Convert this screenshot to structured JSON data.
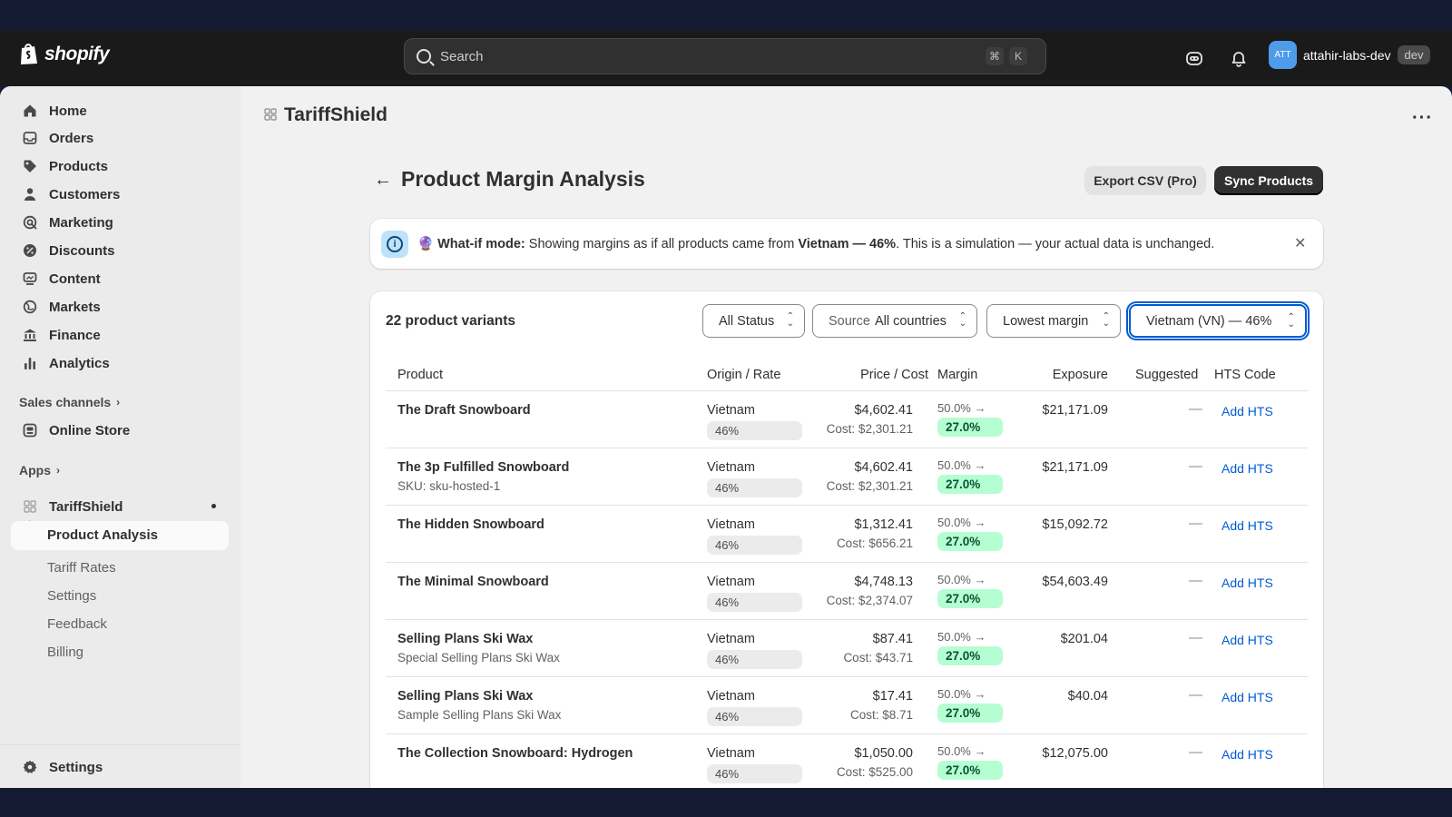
{
  "topbar": {
    "brand": "shopify",
    "search_placeholder": "Search",
    "shortcut_keys": [
      "⌘",
      "K"
    ],
    "avatar_initials": "ATT",
    "store_name": "attahir-labs-dev",
    "env_badge": "dev"
  },
  "sidebar": {
    "items": [
      {
        "label": "Home",
        "icon": "home-icon"
      },
      {
        "label": "Orders",
        "icon": "inbox-icon"
      },
      {
        "label": "Products",
        "icon": "tag-icon"
      },
      {
        "label": "Customers",
        "icon": "person-icon"
      },
      {
        "label": "Marketing",
        "icon": "target-icon"
      },
      {
        "label": "Discounts",
        "icon": "discount-icon"
      },
      {
        "label": "Content",
        "icon": "content-icon"
      },
      {
        "label": "Markets",
        "icon": "globe-icon"
      },
      {
        "label": "Finance",
        "icon": "bank-icon"
      },
      {
        "label": "Analytics",
        "icon": "bar-chart-icon"
      }
    ],
    "sales_channels_label": "Sales channels",
    "online_store_label": "Online Store",
    "apps_label": "Apps",
    "app_name": "TariffShield",
    "app_subitems": [
      "Product Analysis",
      "Tariff Rates",
      "Settings",
      "Feedback",
      "Billing"
    ],
    "settings_label": "Settings"
  },
  "main": {
    "app_title": "TariffShield",
    "page_title": "Product Margin Analysis",
    "export_label": "Export CSV (Pro)",
    "sync_label": "Sync Products"
  },
  "banner": {
    "emoji": "🔮",
    "lead": "What-if mode:",
    "text1": " Showing margins as if all products came from ",
    "highlight": "Vietnam — 46%",
    "text2": ". This is a simulation — your actual data is unchanged."
  },
  "card": {
    "count_label": "22 product variants",
    "filters": {
      "status": "All Status",
      "source_prefix": "Source",
      "source_value": "All countries",
      "sort": "Lowest margin",
      "scenario": "Vietnam (VN) — 46%"
    },
    "columns": [
      "Product",
      "Origin / Rate",
      "Price / Cost",
      "Margin",
      "Exposure",
      "Suggested",
      "HTS Code"
    ],
    "rows": [
      {
        "name": "The Draft Snowboard",
        "sub": "",
        "origin": "Vietnam",
        "rate": "46%",
        "price": "$4,602.41",
        "cost": "Cost: $2,301.21",
        "margin_old": "50.0% →",
        "margin_new": "27.0%",
        "exposure": "$21,171.09",
        "suggested": "—",
        "hts": "Add HTS"
      },
      {
        "name": "The 3p Fulfilled Snowboard",
        "sub": "SKU: sku-hosted-1",
        "origin": "Vietnam",
        "rate": "46%",
        "price": "$4,602.41",
        "cost": "Cost: $2,301.21",
        "margin_old": "50.0% →",
        "margin_new": "27.0%",
        "exposure": "$21,171.09",
        "suggested": "—",
        "hts": "Add HTS"
      },
      {
        "name": "The Hidden Snowboard",
        "sub": "",
        "origin": "Vietnam",
        "rate": "46%",
        "price": "$1,312.41",
        "cost": "Cost: $656.21",
        "margin_old": "50.0% →",
        "margin_new": "27.0%",
        "exposure": "$15,092.72",
        "suggested": "—",
        "hts": "Add HTS"
      },
      {
        "name": "The Minimal Snowboard",
        "sub": "",
        "origin": "Vietnam",
        "rate": "46%",
        "price": "$4,748.13",
        "cost": "Cost: $2,374.07",
        "margin_old": "50.0% →",
        "margin_new": "27.0%",
        "exposure": "$54,603.49",
        "suggested": "—",
        "hts": "Add HTS"
      },
      {
        "name": "Selling Plans Ski Wax",
        "sub": "Special Selling Plans Ski Wax",
        "origin": "Vietnam",
        "rate": "46%",
        "price": "$87.41",
        "cost": "Cost: $43.71",
        "margin_old": "50.0% →",
        "margin_new": "27.0%",
        "exposure": "$201.04",
        "suggested": "—",
        "hts": "Add HTS"
      },
      {
        "name": "Selling Plans Ski Wax",
        "sub": "Sample Selling Plans Ski Wax",
        "origin": "Vietnam",
        "rate": "46%",
        "price": "$17.41",
        "cost": "Cost: $8.71",
        "margin_old": "50.0% →",
        "margin_new": "27.0%",
        "exposure": "$40.04",
        "suggested": "—",
        "hts": "Add HTS"
      },
      {
        "name": "The Collection Snowboard: Hydrogen",
        "sub": "",
        "origin": "Vietnam",
        "rate": "46%",
        "price": "$1,050.00",
        "cost": "Cost: $525.00",
        "margin_old": "50.0% →",
        "margin_new": "27.0%",
        "exposure": "$12,075.00",
        "suggested": "—",
        "hts": "Add HTS"
      }
    ]
  },
  "colors": {
    "topbar_bg": "#1a1a1a",
    "link": "#005bd3",
    "margin_pill_bg": "#b4fed2",
    "focus_ring": "#005bd3"
  }
}
